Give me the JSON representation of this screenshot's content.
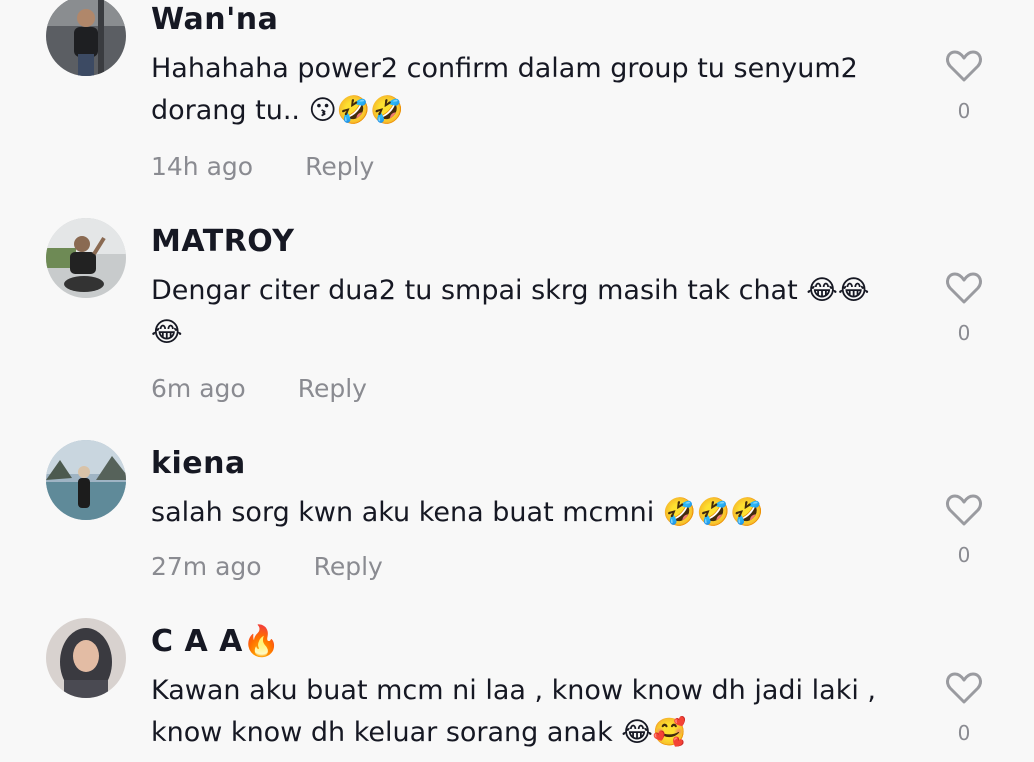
{
  "comments": [
    {
      "username": "Wan'na",
      "text": "Hahahaha power2 confirm dalam group tu senyum2 dorang tu.. 😗🤣🤣",
      "time": "14h ago",
      "reply": "Reply",
      "likes": "0",
      "avatar_icon": "avatar-photo-man-standing"
    },
    {
      "username": "MATROY",
      "text": "Dengar citer dua2 tu smpai skrg masih tak chat 😂😂 😂",
      "time": "6m ago",
      "reply": "Reply",
      "likes": "0",
      "avatar_icon": "avatar-photo-man-on-motorbike"
    },
    {
      "username": "kiena",
      "text": "salah sorg kwn aku kena buat mcmni 🤣🤣🤣",
      "time": "27m ago",
      "reply": "Reply",
      "likes": "0",
      "avatar_icon": "avatar-photo-woman-at-sea"
    },
    {
      "username": "C A A🔥",
      "text": "Kawan aku buat mcm ni laa , know know dh jadi laki , know know dh keluar sorang anak 😂🥰",
      "time": "",
      "reply": "",
      "likes": "0",
      "avatar_icon": "avatar-photo-woman-hijab"
    }
  ],
  "colors": {
    "background": "#f8f8f8",
    "username": "#161823",
    "meta": "#8a8b91"
  }
}
